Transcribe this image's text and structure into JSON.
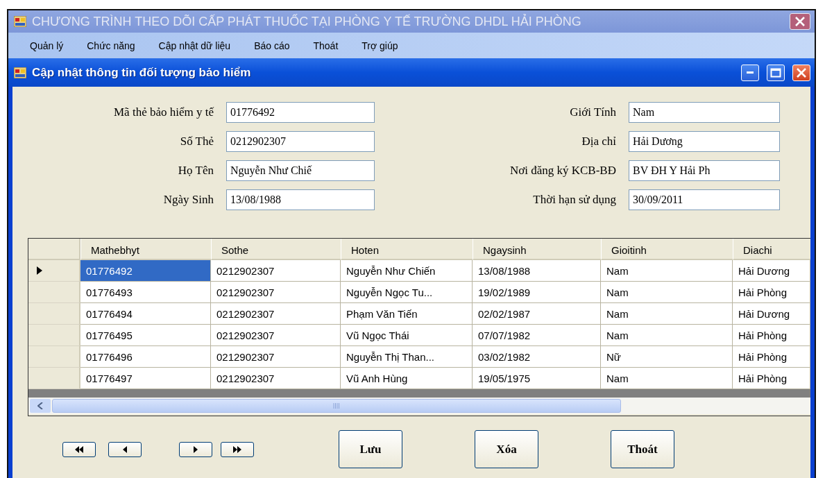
{
  "app_window": {
    "title": "CHƯƠNG TRÌNH THEO DÕI CẤP PHÁT THUỐC TẠI PHÒNG Y TẾ TRƯỜNG DHDL HẢI PHÒNG"
  },
  "menu": [
    "Quản lý",
    "Chức năng",
    "Cập nhật dữ liệu",
    "Báo cáo",
    "Thoát",
    "Trợ giúp"
  ],
  "form_window": {
    "title": "Cập nhật thông tin đối tượng bảo hiểm"
  },
  "fields_left": [
    {
      "label": "Mã thẻ bảo hiểm y tế",
      "value": "01776492"
    },
    {
      "label": "Số Thẻ",
      "value": "0212902307"
    },
    {
      "label": "Họ Tên",
      "value": "Nguyễn Như Chiế"
    },
    {
      "label": "Ngày Sinh",
      "value": "13/08/1988"
    }
  ],
  "fields_right": [
    {
      "label": "Giới Tính",
      "value": "Nam"
    },
    {
      "label": "Địa chỉ",
      "value": "Hải Dương"
    },
    {
      "label": "Nơi đăng ký  KCB-BĐ",
      "value": "BV ĐH Y Hải Ph"
    },
    {
      "label": "Thời hạn sử dụng",
      "value": "30/09/2011"
    }
  ],
  "table": {
    "columns": [
      "Mathebhyt",
      "Sothe",
      "Hoten",
      "Ngaysinh",
      "Gioitinh",
      "Diachi"
    ],
    "rows": [
      {
        "selected": true,
        "cells": [
          "01776492",
          "0212902307",
          "Nguyễn Như Chiến",
          "13/08/1988",
          "Nam",
          "Hải Dương"
        ]
      },
      {
        "selected": false,
        "cells": [
          "01776493",
          "0212902307",
          "Nguyễn Ngọc Tu...",
          "19/02/1989",
          "Nam",
          "Hải Phòng"
        ]
      },
      {
        "selected": false,
        "cells": [
          "01776494",
          "0212902307",
          "Phạm Văn Tiến",
          "02/02/1987",
          "Nam",
          "Hải Dương"
        ]
      },
      {
        "selected": false,
        "cells": [
          "01776495",
          "0212902307",
          "Vũ Ngọc Thái",
          "07/07/1982",
          "Nam",
          "Hải Phòng"
        ]
      },
      {
        "selected": false,
        "cells": [
          "01776496",
          "0212902307",
          "Nguyễn Thị Than...",
          "03/02/1982",
          "Nữ",
          "Hải Phòng"
        ]
      },
      {
        "selected": false,
        "cells": [
          "01776497",
          "0212902307",
          "Vũ Anh Hùng",
          "19/05/1975",
          "Nam",
          "Hải Phòng"
        ]
      }
    ]
  },
  "nav_buttons": [
    {
      "kind": "first"
    },
    {
      "kind": "prev"
    },
    {
      "kind": "next"
    },
    {
      "kind": "last"
    }
  ],
  "buttons": [
    "Lưu",
    "Xóa",
    "Thoát"
  ]
}
